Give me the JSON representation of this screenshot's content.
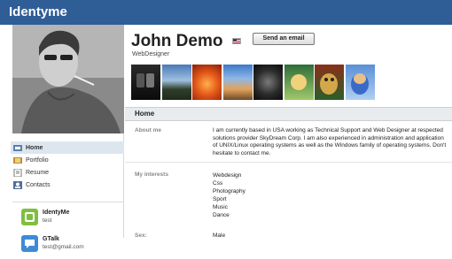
{
  "app": {
    "logo": "Identyme"
  },
  "profile": {
    "name": "John Demo",
    "title": "WebDesigner",
    "email_button": "Send an email"
  },
  "nav": {
    "items": [
      {
        "label": "Home",
        "icon": "home-icon",
        "active": true
      },
      {
        "label": "Portfolio",
        "icon": "portfolio-icon",
        "active": false
      },
      {
        "label": "Resume",
        "icon": "resume-icon",
        "active": false
      },
      {
        "label": "Contacts",
        "icon": "contacts-icon",
        "active": false
      }
    ]
  },
  "contacts": [
    {
      "name": "IdentyMe",
      "sub": "test",
      "icon": "identyme-icon",
      "color": "#7fbf3f"
    },
    {
      "name": "GTalk",
      "sub": "test@gmail.com",
      "icon": "gtalk-icon",
      "color": "#3d8bd8"
    }
  ],
  "section": {
    "title": "Home",
    "about_label": "About me",
    "about_text": "I am currently based in USA working as Technical Support and Web Designer at respected solutions provider SkyDream Corp. I am also experienced in administration and application of UNIX/Linux operating systems as well as the Windows family of operating systems. Don't hesitate to contact me.",
    "interests_label": "My interests",
    "interests": [
      "Webdesign",
      "Css",
      "Photography",
      "Sport",
      "Music",
      "Dance"
    ],
    "sex_label": "Sex:",
    "sex_value": "Male"
  },
  "colors": {
    "topbar": "#2f5d96",
    "nav_active": "#dde6ef",
    "section_head": "#e9ecef"
  }
}
